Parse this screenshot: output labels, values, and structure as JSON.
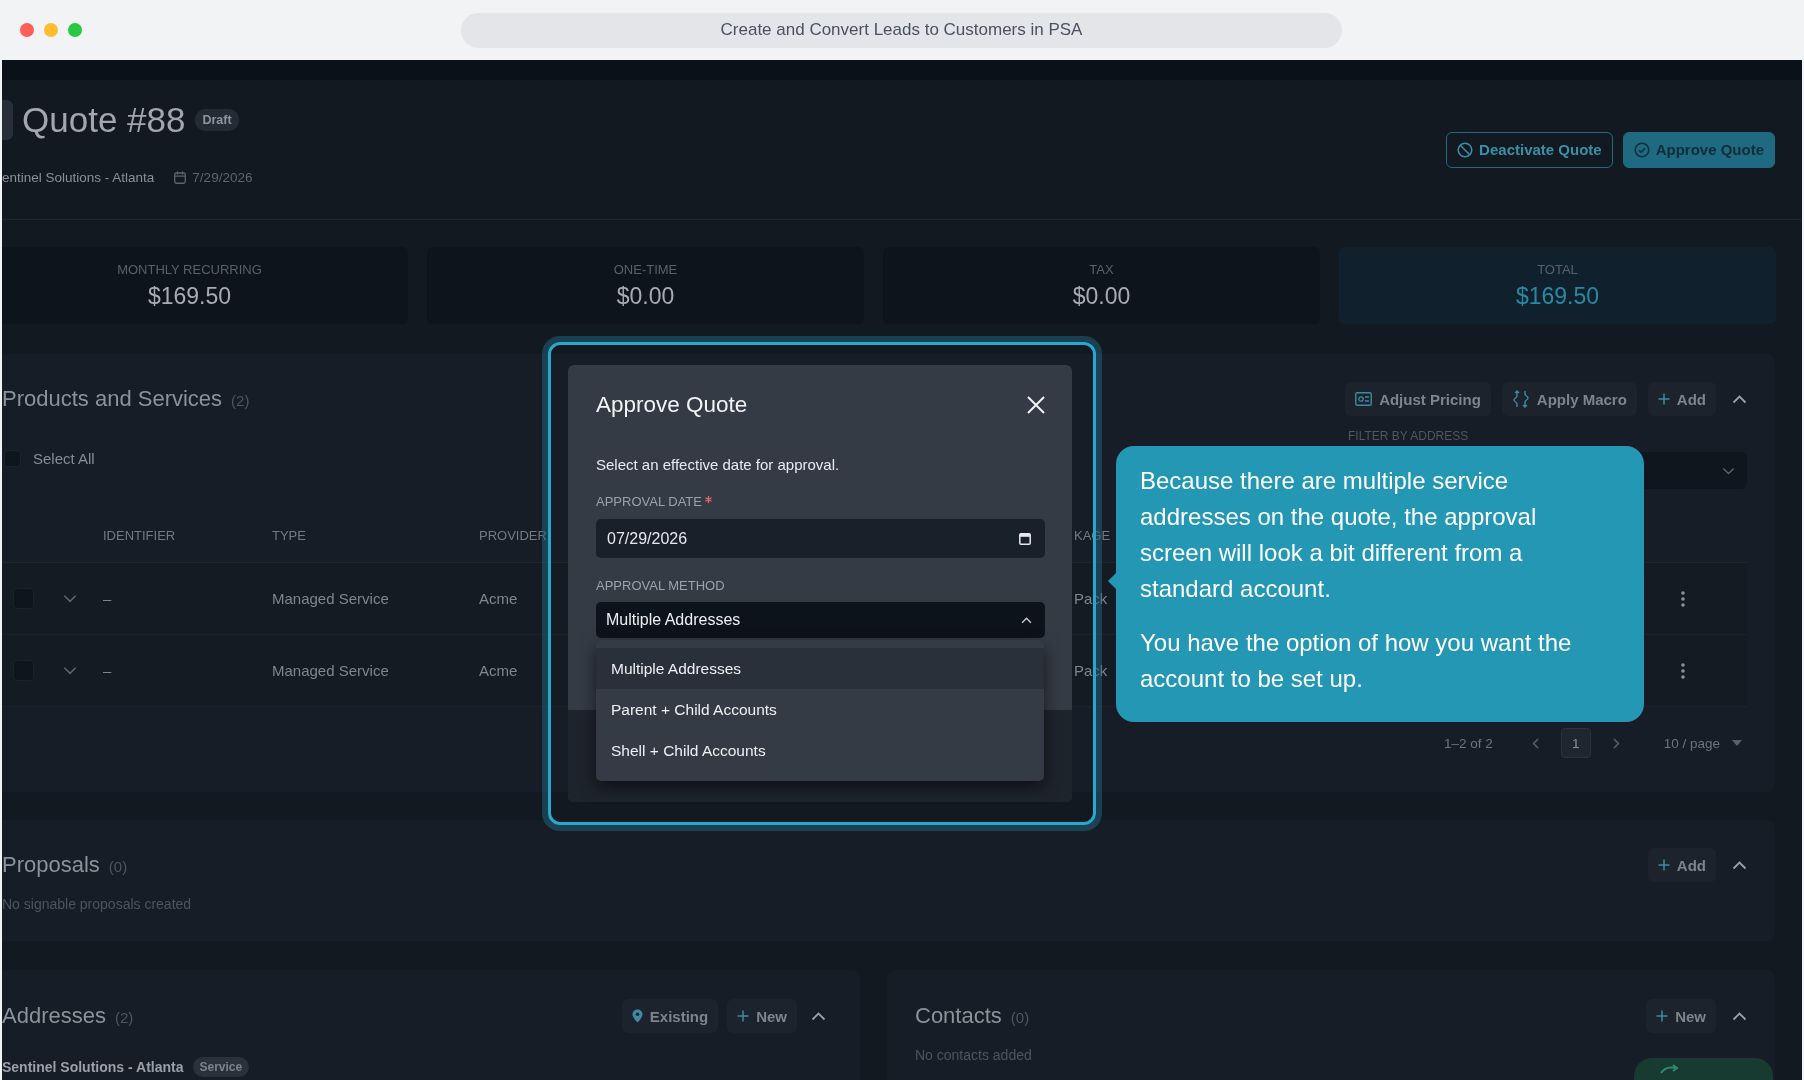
{
  "window": {
    "title": "Create and Convert Leads to Customers in PSA"
  },
  "header": {
    "title": "Quote #88",
    "status": "Draft",
    "account": "entinel Solutions - Atlanta",
    "date": "7/29/2026",
    "actions": [
      {
        "label": "Deactivate Quote",
        "kind": "deactivate"
      },
      {
        "label": "Approve Quote",
        "kind": "approve"
      }
    ]
  },
  "summary": [
    {
      "label": "MONTHLY RECURRING",
      "value": "$169.50",
      "highlighted": false
    },
    {
      "label": "ONE-TIME",
      "value": "$0.00",
      "highlighted": false
    },
    {
      "label": "TAX",
      "value": "$0.00",
      "highlighted": false
    },
    {
      "label": "TOTAL",
      "value": "$169.50",
      "highlighted": true
    }
  ],
  "products": {
    "title": "Products and Services",
    "count": "(2)",
    "expanded": true,
    "actions": [
      {
        "label": "Adjust Pricing",
        "kind": "pricing"
      },
      {
        "label": "Apply Macro",
        "kind": "macro"
      },
      {
        "label": "Add",
        "kind": "add"
      }
    ],
    "select_all": {
      "label": "Select All",
      "checked": false
    },
    "filter": {
      "label": "FILTER BY ADDRESS"
    },
    "columns": [
      "IDENTIFIER",
      "TYPE",
      "PROVIDER",
      "KAGE"
    ],
    "rows": [
      {
        "checked": false,
        "expanded": false,
        "identifier": "–",
        "type": "Managed Service",
        "provider": "Acme",
        "package": "Pack"
      },
      {
        "checked": false,
        "expanded": false,
        "identifier": "–",
        "type": "Managed Service",
        "provider": "Acme",
        "package": "Pack"
      }
    ],
    "pagination": {
      "range": "1–2 of 2",
      "pages": [
        {
          "label": "1",
          "selected": true
        }
      ],
      "page_size": "10 / page"
    }
  },
  "proposals": {
    "title": "Proposals",
    "count": "(0)",
    "expanded": true,
    "actions": [
      {
        "label": "Add",
        "kind": "add"
      }
    ],
    "empty": "No signable proposals created"
  },
  "addresses": {
    "title": "Addresses",
    "count": "(2)",
    "expanded": true,
    "actions": [
      {
        "label": "Existing",
        "kind": "existing"
      },
      {
        "label": "New",
        "kind": "add"
      }
    ],
    "items": [
      {
        "name": "Sentinel Solutions - Atlanta",
        "tag": "Service"
      }
    ]
  },
  "contacts": {
    "title": "Contacts",
    "count": "(0)",
    "expanded": true,
    "actions": [
      {
        "label": "New",
        "kind": "add"
      }
    ],
    "empty": "No contacts added"
  },
  "dialog": {
    "title": "Approve Quote",
    "intro": "Select an effective date for approval.",
    "fields": [
      {
        "kind": "date",
        "label": "APPROVAL DATE",
        "required": true,
        "value": "07/29/2026"
      },
      {
        "kind": "select",
        "label": "APPROVAL METHOD",
        "required": false,
        "value": "Multiple Addresses",
        "expanded": true,
        "options": [
          {
            "label": "Multiple Addresses",
            "selected": true
          },
          {
            "label": "Parent + Child Accounts",
            "selected": false
          },
          {
            "label": "Shell + Child Accounts",
            "selected": false
          }
        ]
      }
    ]
  },
  "tooltip": {
    "paragraphs": [
      "Because there are multiple service addresses on the quote, the approval screen will look a bit different from a standard account.",
      "You have the option of how you want the account to be set up."
    ]
  }
}
